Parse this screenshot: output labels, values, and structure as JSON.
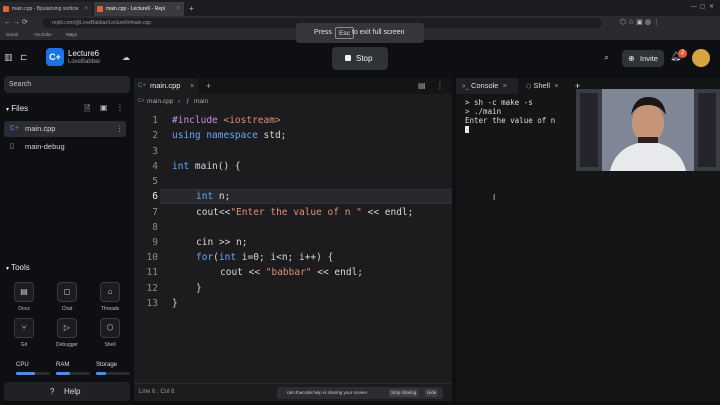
{
  "browser": {
    "tabs": [
      {
        "label": "main.cpp - Bpularising sorticw"
      },
      {
        "label": "main.cpp - Lecture6 - Repl"
      }
    ],
    "url": "replit.com/@LoveBabbar/Lecture6#main.cpp",
    "bookmarks": [
      "Gmail",
      "YouTube",
      "Maps"
    ],
    "fullscreen_toast": {
      "press": "Press",
      "key": "Esc",
      "rest": "to exit full screen"
    }
  },
  "header": {
    "repl_name": "Lecture6",
    "owner": "LoveBabbar",
    "logo_letter": "C+",
    "stop_label": "Stop",
    "invite_label": "Invite",
    "bell_count": "2"
  },
  "sidebar": {
    "search_placeholder": "Search",
    "files_title": "Files",
    "files": [
      {
        "name": "main.cpp",
        "active": true
      },
      {
        "name": "main-debug",
        "active": false
      }
    ],
    "tools_title": "Tools",
    "tools": [
      {
        "label": "Docs",
        "icon": "▤"
      },
      {
        "label": "Chat",
        "icon": "◻"
      },
      {
        "label": "Threads",
        "icon": "⌂"
      },
      {
        "label": "Git",
        "icon": "⑂"
      },
      {
        "label": "Debugger",
        "icon": "▷"
      },
      {
        "label": "Shell",
        "icon": "⬡"
      }
    ],
    "meters": [
      {
        "label": "CPU",
        "fill": 0.55
      },
      {
        "label": "RAM",
        "fill": 0.4
      },
      {
        "label": "Storage",
        "fill": 0.3
      }
    ],
    "help_label": "Help"
  },
  "editor": {
    "tab_label": "main.cpp",
    "breadcrumb_file": "main.cpp",
    "breadcrumb_symbol": "main",
    "status": "Line 6 : Col 8",
    "lines": [
      "1",
      "2",
      "3",
      "4",
      "5",
      "6",
      "7",
      "8",
      "9",
      "10",
      "11",
      "12",
      "13"
    ],
    "code": {
      "l1_inc": "#include",
      "l1_hdr": " <iostream>",
      "l2_kw": "using namespace",
      "l2_rest": " std;",
      "l4_kw": "int",
      "l4_rest": " main() {",
      "l6_kw": "int",
      "l6_rest": " n;",
      "l7_pre": "cout<<",
      "l7_str": "\"Enter the value of n \"",
      "l7_post": " << endl;",
      "l9": "cin >> n;",
      "l10_kw1": "for",
      "l10_a": "(",
      "l10_kw2": "int",
      "l10_b": " i=0; i<n; i++) {",
      "l11_pre": "cout << ",
      "l11_str": "\"babbar\"",
      "l11_post": " << endl;",
      "l12": "}",
      "l13": "}"
    }
  },
  "console": {
    "tab_console": "Console",
    "tab_shell": "Shell",
    "lines": [
      "> sh -c make -s",
      "> ./main",
      "Enter the value of n"
    ]
  },
  "share_notice": {
    "text": "ram.thecode.help is sharing your screen",
    "stop": "Stop sharing",
    "hide": "Hide"
  },
  "colors": {
    "accent": "#1a73e8",
    "keyword": "#6aa6ff",
    "string": "#e38e74"
  }
}
